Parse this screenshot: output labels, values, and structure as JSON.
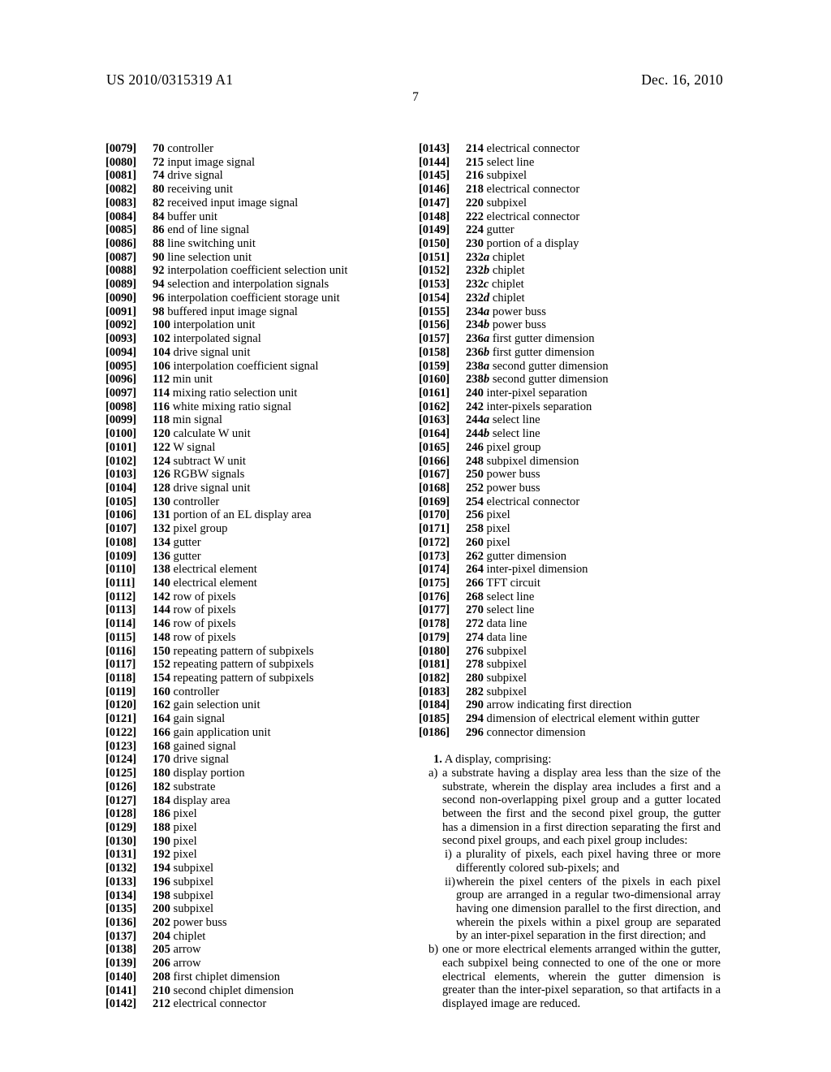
{
  "header": {
    "publication_number": "US 2010/0315319 A1",
    "publication_date": "Dec. 16, 2010",
    "page_number": "7"
  },
  "left_column": [
    {
      "para": "[0079]",
      "num": "70",
      "suffix": "",
      "label": "controller"
    },
    {
      "para": "[0080]",
      "num": "72",
      "suffix": "",
      "label": "input image signal"
    },
    {
      "para": "[0081]",
      "num": "74",
      "suffix": "",
      "label": "drive signal"
    },
    {
      "para": "[0082]",
      "num": "80",
      "suffix": "",
      "label": "receiving unit"
    },
    {
      "para": "[0083]",
      "num": "82",
      "suffix": "",
      "label": "received input image signal"
    },
    {
      "para": "[0084]",
      "num": "84",
      "suffix": "",
      "label": "buffer unit"
    },
    {
      "para": "[0085]",
      "num": "86",
      "suffix": "",
      "label": "end of line signal"
    },
    {
      "para": "[0086]",
      "num": "88",
      "suffix": "",
      "label": "line switching unit"
    },
    {
      "para": "[0087]",
      "num": "90",
      "suffix": "",
      "label": "line selection unit"
    },
    {
      "para": "[0088]",
      "num": "92",
      "suffix": "",
      "label": "interpolation coefficient selection unit"
    },
    {
      "para": "[0089]",
      "num": "94",
      "suffix": "",
      "label": "selection and interpolation signals"
    },
    {
      "para": "[0090]",
      "num": "96",
      "suffix": "",
      "label": "interpolation coefficient storage unit"
    },
    {
      "para": "[0091]",
      "num": "98",
      "suffix": "",
      "label": "buffered input image signal"
    },
    {
      "para": "[0092]",
      "num": "100",
      "suffix": "",
      "label": "interpolation unit"
    },
    {
      "para": "[0093]",
      "num": "102",
      "suffix": "",
      "label": "interpolated signal"
    },
    {
      "para": "[0094]",
      "num": "104",
      "suffix": "",
      "label": "drive signal unit"
    },
    {
      "para": "[0095]",
      "num": "106",
      "suffix": "",
      "label": "interpolation coefficient signal"
    },
    {
      "para": "[0096]",
      "num": "112",
      "suffix": "",
      "label": "min unit"
    },
    {
      "para": "[0097]",
      "num": "114",
      "suffix": "",
      "label": "mixing ratio selection unit"
    },
    {
      "para": "[0098]",
      "num": "116",
      "suffix": "",
      "label": "white mixing ratio signal"
    },
    {
      "para": "[0099]",
      "num": "118",
      "suffix": "",
      "label": "min signal"
    },
    {
      "para": "[0100]",
      "num": "120",
      "suffix": "",
      "label": "calculate W unit"
    },
    {
      "para": "[0101]",
      "num": "122",
      "suffix": "",
      "label": "W signal"
    },
    {
      "para": "[0102]",
      "num": "124",
      "suffix": "",
      "label": "subtract W unit"
    },
    {
      "para": "[0103]",
      "num": "126",
      "suffix": "",
      "label": "RGBW signals"
    },
    {
      "para": "[0104]",
      "num": "128",
      "suffix": "",
      "label": "drive signal unit"
    },
    {
      "para": "[0105]",
      "num": "130",
      "suffix": "",
      "label": "controller"
    },
    {
      "para": "[0106]",
      "num": "131",
      "suffix": "",
      "label": "portion of an EL display area"
    },
    {
      "para": "[0107]",
      "num": "132",
      "suffix": "",
      "label": "pixel group"
    },
    {
      "para": "[0108]",
      "num": "134",
      "suffix": "",
      "label": "gutter"
    },
    {
      "para": "[0109]",
      "num": "136",
      "suffix": "",
      "label": "gutter"
    },
    {
      "para": "[0110]",
      "num": "138",
      "suffix": "",
      "label": "electrical element"
    },
    {
      "para": "[0111]",
      "num": "140",
      "suffix": "",
      "label": "electrical element"
    },
    {
      "para": "[0112]",
      "num": "142",
      "suffix": "",
      "label": "row of pixels"
    },
    {
      "para": "[0113]",
      "num": "144",
      "suffix": "",
      "label": "row of pixels"
    },
    {
      "para": "[0114]",
      "num": "146",
      "suffix": "",
      "label": "row of pixels"
    },
    {
      "para": "[0115]",
      "num": "148",
      "suffix": "",
      "label": "row of pixels"
    },
    {
      "para": "[0116]",
      "num": "150",
      "suffix": "",
      "label": "repeating pattern of subpixels"
    },
    {
      "para": "[0117]",
      "num": "152",
      "suffix": "",
      "label": "repeating pattern of subpixels"
    },
    {
      "para": "[0118]",
      "num": "154",
      "suffix": "",
      "label": "repeating pattern of subpixels"
    },
    {
      "para": "[0119]",
      "num": "160",
      "suffix": "",
      "label": "controller"
    },
    {
      "para": "[0120]",
      "num": "162",
      "suffix": "",
      "label": "gain selection unit"
    },
    {
      "para": "[0121]",
      "num": "164",
      "suffix": "",
      "label": "gain signal"
    },
    {
      "para": "[0122]",
      "num": "166",
      "suffix": "",
      "label": "gain application unit"
    },
    {
      "para": "[0123]",
      "num": "168",
      "suffix": "",
      "label": "gained signal"
    },
    {
      "para": "[0124]",
      "num": "170",
      "suffix": "",
      "label": "drive signal"
    },
    {
      "para": "[0125]",
      "num": "180",
      "suffix": "",
      "label": "display portion"
    },
    {
      "para": "[0126]",
      "num": "182",
      "suffix": "",
      "label": "substrate"
    },
    {
      "para": "[0127]",
      "num": "184",
      "suffix": "",
      "label": "display area"
    },
    {
      "para": "[0128]",
      "num": "186",
      "suffix": "",
      "label": "pixel"
    },
    {
      "para": "[0129]",
      "num": "188",
      "suffix": "",
      "label": "pixel"
    },
    {
      "para": "[0130]",
      "num": "190",
      "suffix": "",
      "label": "pixel"
    },
    {
      "para": "[0131]",
      "num": "192",
      "suffix": "",
      "label": "pixel"
    },
    {
      "para": "[0132]",
      "num": "194",
      "suffix": "",
      "label": "subpixel"
    },
    {
      "para": "[0133]",
      "num": "196",
      "suffix": "",
      "label": "subpixel"
    },
    {
      "para": "[0134]",
      "num": "198",
      "suffix": "",
      "label": "subpixel"
    },
    {
      "para": "[0135]",
      "num": "200",
      "suffix": "",
      "label": "subpixel"
    },
    {
      "para": "[0136]",
      "num": "202",
      "suffix": "",
      "label": "power buss"
    },
    {
      "para": "[0137]",
      "num": "204",
      "suffix": "",
      "label": "chiplet"
    },
    {
      "para": "[0138]",
      "num": "205",
      "suffix": "",
      "label": "arrow"
    },
    {
      "para": "[0139]",
      "num": "206",
      "suffix": "",
      "label": "arrow"
    },
    {
      "para": "[0140]",
      "num": "208",
      "suffix": "",
      "label": "first chiplet dimension"
    },
    {
      "para": "[0141]",
      "num": "210",
      "suffix": "",
      "label": "second chiplet dimension"
    },
    {
      "para": "[0142]",
      "num": "212",
      "suffix": "",
      "label": "electrical connector"
    }
  ],
  "right_column": [
    {
      "para": "[0143]",
      "num": "214",
      "suffix": "",
      "label": "electrical connector"
    },
    {
      "para": "[0144]",
      "num": "215",
      "suffix": "",
      "label": "select line"
    },
    {
      "para": "[0145]",
      "num": "216",
      "suffix": "",
      "label": "subpixel"
    },
    {
      "para": "[0146]",
      "num": "218",
      "suffix": "",
      "label": "electrical connector"
    },
    {
      "para": "[0147]",
      "num": "220",
      "suffix": "",
      "label": "subpixel"
    },
    {
      "para": "[0148]",
      "num": "222",
      "suffix": "",
      "label": "electrical connector"
    },
    {
      "para": "[0149]",
      "num": "224",
      "suffix": "",
      "label": "gutter"
    },
    {
      "para": "[0150]",
      "num": "230",
      "suffix": "",
      "label": "portion of a display"
    },
    {
      "para": "[0151]",
      "num": "232",
      "suffix": "a",
      "label": "chiplet"
    },
    {
      "para": "[0152]",
      "num": "232",
      "suffix": "b",
      "label": "chiplet"
    },
    {
      "para": "[0153]",
      "num": "232",
      "suffix": "c",
      "label": "chiplet"
    },
    {
      "para": "[0154]",
      "num": "232",
      "suffix": "d",
      "label": "chiplet"
    },
    {
      "para": "[0155]",
      "num": "234",
      "suffix": "a",
      "label": "power buss"
    },
    {
      "para": "[0156]",
      "num": "234",
      "suffix": "b",
      "label": "power buss"
    },
    {
      "para": "[0157]",
      "num": "236",
      "suffix": "a",
      "label": "first gutter dimension"
    },
    {
      "para": "[0158]",
      "num": "236",
      "suffix": "b",
      "label": "first gutter dimension"
    },
    {
      "para": "[0159]",
      "num": "238",
      "suffix": "a",
      "label": "second gutter dimension"
    },
    {
      "para": "[0160]",
      "num": "238",
      "suffix": "b",
      "label": "second gutter dimension"
    },
    {
      "para": "[0161]",
      "num": "240",
      "suffix": "",
      "label": "inter-pixel separation"
    },
    {
      "para": "[0162]",
      "num": "242",
      "suffix": "",
      "label": "inter-pixels separation"
    },
    {
      "para": "[0163]",
      "num": "244",
      "suffix": "a",
      "label": "select line"
    },
    {
      "para": "[0164]",
      "num": "244",
      "suffix": "b",
      "label": "select line"
    },
    {
      "para": "[0165]",
      "num": "246",
      "suffix": "",
      "label": "pixel group"
    },
    {
      "para": "[0166]",
      "num": "248",
      "suffix": "",
      "label": "subpixel dimension"
    },
    {
      "para": "[0167]",
      "num": "250",
      "suffix": "",
      "label": "power buss"
    },
    {
      "para": "[0168]",
      "num": "252",
      "suffix": "",
      "label": "power buss"
    },
    {
      "para": "[0169]",
      "num": "254",
      "suffix": "",
      "label": "electrical connector"
    },
    {
      "para": "[0170]",
      "num": "256",
      "suffix": "",
      "label": "pixel"
    },
    {
      "para": "[0171]",
      "num": "258",
      "suffix": "",
      "label": "pixel"
    },
    {
      "para": "[0172]",
      "num": "260",
      "suffix": "",
      "label": "pixel"
    },
    {
      "para": "[0173]",
      "num": "262",
      "suffix": "",
      "label": "gutter dimension"
    },
    {
      "para": "[0174]",
      "num": "264",
      "suffix": "",
      "label": "inter-pixel dimension"
    },
    {
      "para": "[0175]",
      "num": "266",
      "suffix": "",
      "label": "TFT circuit"
    },
    {
      "para": "[0176]",
      "num": "268",
      "suffix": "",
      "label": "select line"
    },
    {
      "para": "[0177]",
      "num": "270",
      "suffix": "",
      "label": "select line"
    },
    {
      "para": "[0178]",
      "num": "272",
      "suffix": "",
      "label": "data line"
    },
    {
      "para": "[0179]",
      "num": "274",
      "suffix": "",
      "label": "data line"
    },
    {
      "para": "[0180]",
      "num": "276",
      "suffix": "",
      "label": "subpixel"
    },
    {
      "para": "[0181]",
      "num": "278",
      "suffix": "",
      "label": "subpixel"
    },
    {
      "para": "[0182]",
      "num": "280",
      "suffix": "",
      "label": "subpixel"
    },
    {
      "para": "[0183]",
      "num": "282",
      "suffix": "",
      "label": "subpixel"
    },
    {
      "para": "[0184]",
      "num": "290",
      "suffix": "",
      "label": "arrow indicating first direction"
    },
    {
      "para": "[0185]",
      "num": "294",
      "suffix": "",
      "label": "dimension of electrical element within gutter"
    },
    {
      "para": "[0186]",
      "num": "296",
      "suffix": "",
      "label": "connector dimension"
    }
  ],
  "claims": {
    "claim1_number": "1.",
    "claim1_preamble": "A display, comprising:",
    "part_a_marker": "a)",
    "part_a_text": "a substrate having a display area less than the size of the substrate, wherein the display area includes a first and a second non-overlapping pixel group and a gutter located between the first and the second pixel group, the gutter has a dimension in a first direction separating the first and second pixel groups, and each pixel group includes:",
    "sub_i_marker": "i)",
    "sub_i_text": "a plurality of pixels, each pixel having three or more differently colored sub-pixels; and",
    "sub_ii_marker": "ii)",
    "sub_ii_text": "wherein the pixel centers of the pixels in each pixel group are arranged in a regular two-dimensional array having one dimension parallel to the first direction, and wherein the pixels within a pixel group are separated by an inter-pixel separation in the first direction; and",
    "part_b_marker": "b)",
    "part_b_text": "one or more electrical elements arranged within the gutter, each subpixel being connected to one of the one or more electrical elements, wherein the gutter dimension is greater than the inter-pixel separation, so that artifacts in a displayed image are reduced."
  }
}
